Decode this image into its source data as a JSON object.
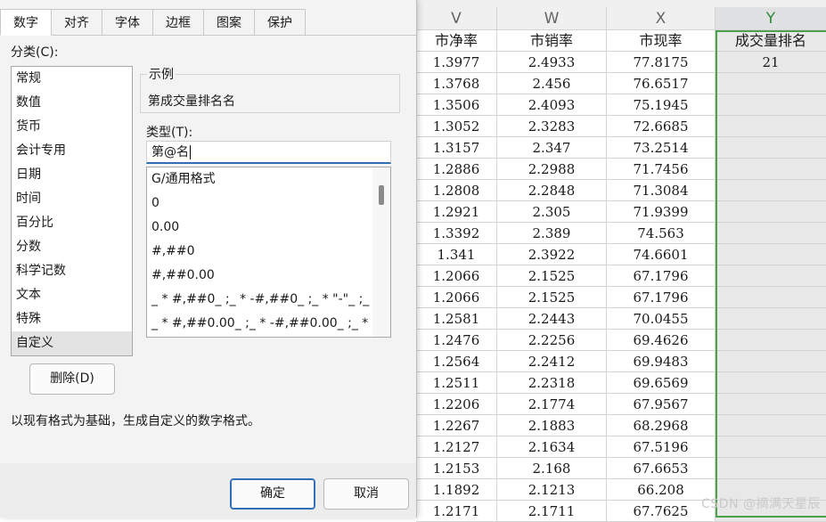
{
  "sheet": {
    "columns": [
      "V",
      "W",
      "X",
      "Y"
    ],
    "headers": [
      "市净率",
      "市销率",
      "市现率",
      "成交量排名"
    ],
    "rows": [
      [
        "1.3977",
        "2.4933",
        "77.8175",
        "21"
      ],
      [
        "1.3768",
        "2.456",
        "76.6517",
        ""
      ],
      [
        "1.3506",
        "2.4093",
        "75.1945",
        ""
      ],
      [
        "1.3052",
        "2.3283",
        "72.6685",
        ""
      ],
      [
        "1.3157",
        "2.347",
        "73.2514",
        ""
      ],
      [
        "1.2886",
        "2.2988",
        "71.7456",
        ""
      ],
      [
        "1.2808",
        "2.2848",
        "71.3084",
        ""
      ],
      [
        "1.2921",
        "2.305",
        "71.9399",
        ""
      ],
      [
        "1.3392",
        "2.389",
        "74.563",
        ""
      ],
      [
        "1.341",
        "2.3922",
        "74.6601",
        ""
      ],
      [
        "1.2066",
        "2.1525",
        "67.1796",
        ""
      ],
      [
        "1.2066",
        "2.1525",
        "67.1796",
        ""
      ],
      [
        "1.2581",
        "2.2443",
        "70.0455",
        ""
      ],
      [
        "1.2476",
        "2.2256",
        "69.4626",
        ""
      ],
      [
        "1.2564",
        "2.2412",
        "69.9483",
        ""
      ],
      [
        "1.2511",
        "2.2318",
        "69.6569",
        ""
      ],
      [
        "1.2206",
        "2.1774",
        "67.9567",
        ""
      ],
      [
        "1.2267",
        "2.1883",
        "68.2968",
        ""
      ],
      [
        "1.2127",
        "2.1634",
        "67.5196",
        ""
      ],
      [
        "1.2153",
        "2.168",
        "67.6653",
        ""
      ],
      [
        "1.1892",
        "2.1213",
        "66.208",
        ""
      ],
      [
        "1.2171",
        "2.1711",
        "67.7625",
        ""
      ]
    ],
    "selected_column": "Y"
  },
  "dialog": {
    "tabs": [
      "数字",
      "对齐",
      "字体",
      "边框",
      "图案",
      "保护"
    ],
    "active_tab": "数字",
    "category_label": "分类(C):",
    "categories": [
      "常规",
      "数值",
      "货币",
      "会计专用",
      "日期",
      "时间",
      "百分比",
      "分数",
      "科学记数",
      "文本",
      "特殊",
      "自定义"
    ],
    "selected_category": "自定义",
    "sample_legend": "示例",
    "sample_value": "第成交量排名名",
    "type_label": "类型(T):",
    "type_value": "第@名",
    "formats": [
      "G/通用格式",
      "0",
      "0.00",
      "#,##0",
      "#,##0.00",
      "_ * #,##0_ ;_ * -#,##0_ ;_ * \"-\"_ ;_ @_",
      "_ * #,##0.00_ ;_ * -#,##0.00_ ;_ * \"-\"??_ ;_ @_"
    ],
    "delete_button": "删除(D)",
    "description": "以现有格式为基础，生成自定义的数字格式。",
    "ok_button": "确定",
    "cancel_button": "取消"
  },
  "watermark": "CSDN @摘满天星辰",
  "colors": {
    "selection_green": "#4aa24a",
    "primary_border": "#2f6fb8"
  }
}
